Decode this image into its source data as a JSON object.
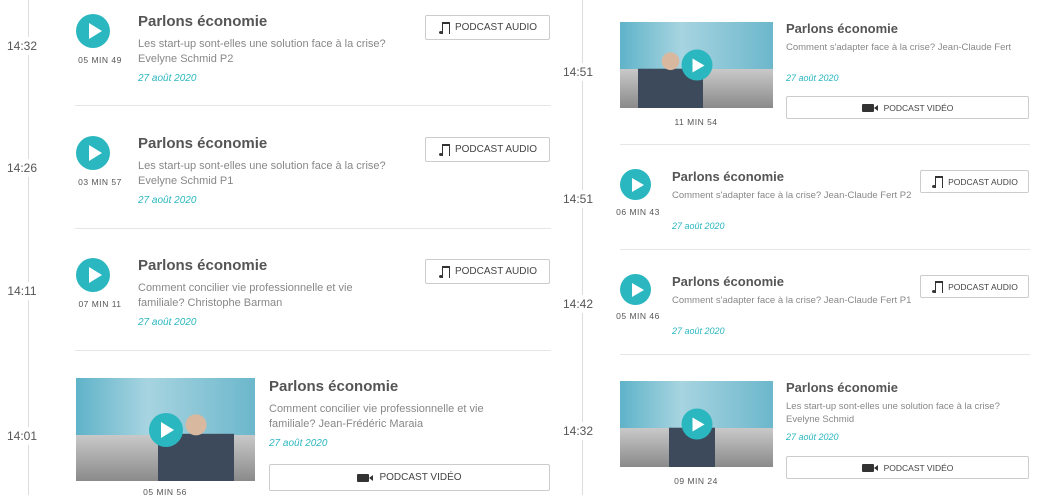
{
  "colors": {
    "accent": "#2bb7c0"
  },
  "left": [
    {
      "time": "14:32",
      "title": "Parlons économie",
      "desc": "Les start-up sont-elles une solution face à la crise? Evelyne Schmid P2",
      "date": "27 août 2020",
      "duration": "05 MIN 49",
      "button": "PODCAST AUDIO",
      "kind": "audio"
    },
    {
      "time": "14:26",
      "title": "Parlons économie",
      "desc": "Les start-up sont-elles une solution face à la crise? Evelyne Schmid P1",
      "date": "27 août 2020",
      "duration": "03 MIN 57",
      "button": "PODCAST AUDIO",
      "kind": "audio"
    },
    {
      "time": "14:11",
      "title": "Parlons économie",
      "desc": "Comment concilier vie professionnelle et vie familiale? Christophe Barman",
      "date": "27 août 2020",
      "duration": "07 MIN 11",
      "button": "PODCAST AUDIO",
      "kind": "audio"
    },
    {
      "time": "14:01",
      "title": "Parlons économie",
      "desc": "Comment concilier vie professionnelle et vie familiale? Jean-Frédéric Maraia",
      "date": "27 août 2020",
      "duration": "05 MIN 56",
      "button": "PODCAST VIDÉO",
      "kind": "video"
    }
  ],
  "right": [
    {
      "time": "14:51",
      "title": "Parlons économie",
      "desc": "Comment s'adapter face à la crise? Jean-Claude Fert",
      "date": "27 août 2020",
      "duration": "11 MIN 54",
      "button": "PODCAST VIDÉO",
      "kind": "video"
    },
    {
      "time": "14:51",
      "title": "Parlons économie",
      "desc": "Comment s'adapter face à la crise? Jean-Claude Fert P2",
      "date": "27 août 2020",
      "duration": "06 MIN 43",
      "button": "PODCAST AUDIO",
      "kind": "audio"
    },
    {
      "time": "14:42",
      "title": "Parlons économie",
      "desc": "Comment s'adapter face à la crise? Jean-Claude Fert P1",
      "date": "27 août 2020",
      "duration": "05 MIN 46",
      "button": "PODCAST AUDIO",
      "kind": "audio"
    },
    {
      "time": "14:32",
      "title": "Parlons économie",
      "desc": "Les start-up sont-elles une solution face à la crise? Evelyne Schmid",
      "date": "27 août 2020",
      "duration": "09 MIN 24",
      "button": "PODCAST VIDÉO",
      "kind": "video"
    }
  ]
}
